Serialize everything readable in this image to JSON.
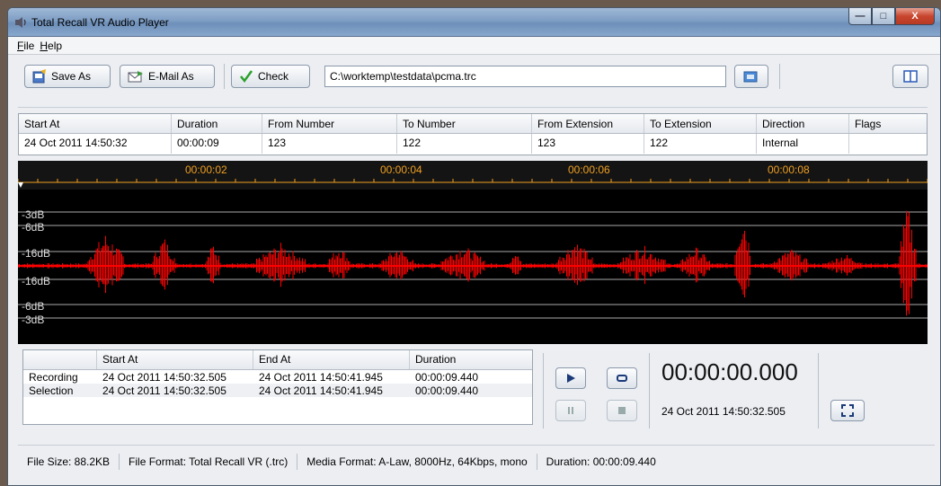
{
  "window": {
    "title": "Total Recall VR Audio Player",
    "controls": [
      "minimize",
      "maximize",
      "close"
    ]
  },
  "menu": [
    "File",
    "Help"
  ],
  "toolbar": {
    "save_as_label": "Save As",
    "email_as_label": "E-Mail As",
    "check_label": "Check",
    "file_path": "C:\\worktemp\\testdata\\pcma.trc"
  },
  "call_table": {
    "columns": [
      "Start At",
      "Duration",
      "From Number",
      "To Number",
      "From Extension",
      "To Extension",
      "Direction",
      "Flags"
    ],
    "rows": [
      [
        "24 Oct 2011 14:50:32",
        "00:00:09",
        "123",
        "122",
        "123",
        "122",
        "Internal",
        ""
      ]
    ]
  },
  "waveform": {
    "timeline_labels": [
      "00:00:02",
      "00:00:04",
      "00:00:06",
      "00:00:08"
    ],
    "db_labels_top": [
      "-3dB",
      "-6dB",
      "-16dB"
    ],
    "db_labels_bottom": [
      "-16dB",
      "-6dB",
      "-3dB"
    ],
    "wave_color": "#ff0000",
    "timeline_color": "#f0a020"
  },
  "segments": {
    "columns": [
      "",
      "Start At",
      "End At",
      "Duration"
    ],
    "rows": [
      [
        "Recording",
        "24 Oct 2011 14:50:32.505",
        "24 Oct 2011 14:50:41.945",
        "00:00:09.440"
      ],
      [
        "Selection",
        "24 Oct 2011 14:50:32.505",
        "24 Oct 2011 14:50:41.945",
        "00:00:09.440"
      ]
    ]
  },
  "player": {
    "time": "00:00:00.000",
    "current_datetime": "24 Oct 2011 14:50:32.505"
  },
  "status": {
    "file_size": "File Size: 88.2KB",
    "file_format": "File Format: Total Recall VR (.trc)",
    "media_format": "Media Format: A-Law, 8000Hz, 64Kbps, mono",
    "duration": "Duration: 00:00:09.440"
  }
}
